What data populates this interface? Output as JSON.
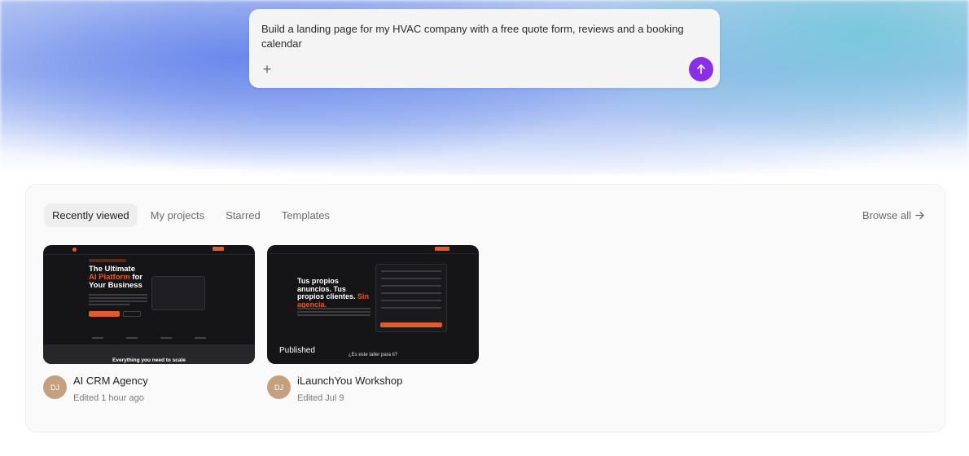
{
  "prompt": {
    "text": "Build a landing page for my HVAC company with a free quote form, reviews and a booking calendar",
    "attach_icon": "plus-icon",
    "send_icon": "arrow-up-icon",
    "send_color": "#8b2fe6"
  },
  "projects": {
    "tabs": [
      {
        "label": "Recently viewed",
        "active": true
      },
      {
        "label": "My projects",
        "active": false
      },
      {
        "label": "Starred",
        "active": false
      },
      {
        "label": "Templates",
        "active": false
      }
    ],
    "browse_all_label": "Browse all",
    "browse_all_icon": "arrow-right-icon",
    "cards": [
      {
        "title": "AI CRM Agency",
        "subtitle": "Edited 1 hour ago",
        "avatar_initials": "DJ",
        "thumbnail": {
          "headline_pre": "The Ultimate",
          "headline_accent": "AI Platform",
          "headline_mid": "for",
          "headline_post": "Your Business",
          "footer_text": "Everything you need to scale"
        }
      },
      {
        "title": "iLaunchYou Workshop",
        "subtitle": "Edited Jul 9",
        "avatar_initials": "DJ",
        "badge": "Published",
        "thumbnail": {
          "headline_pre": "Tus propios anuncios. Tus propios clientes.",
          "headline_accent": "Sin agencia.",
          "footer_text": "¿Es este taller para ti?"
        }
      }
    ]
  },
  "colors": {
    "accent_purple": "#8b2fe6",
    "thumbnail_orange": "#e35b2c",
    "avatar": "#c4a07e"
  }
}
